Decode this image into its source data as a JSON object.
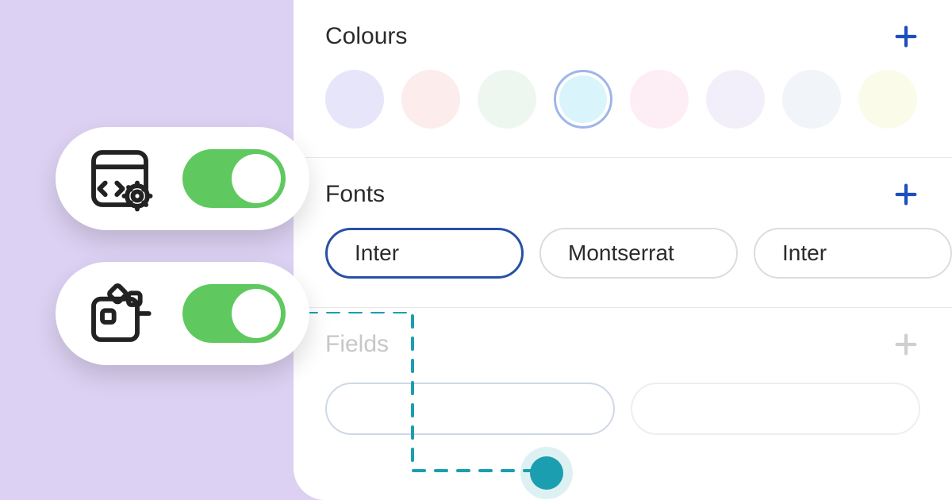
{
  "sections": {
    "colours": {
      "title": "Colours"
    },
    "fonts": {
      "title": "Fonts"
    },
    "fields": {
      "title": "Fields"
    }
  },
  "colour_swatches": [
    {
      "name": "lavender",
      "hex": "#e7e5fa",
      "selected": false
    },
    {
      "name": "blush",
      "hex": "#fcecec",
      "selected": false
    },
    {
      "name": "mint",
      "hex": "#edf7ef",
      "selected": false
    },
    {
      "name": "sky",
      "hex": "#d9f5fb",
      "selected": true
    },
    {
      "name": "rose",
      "hex": "#fceef4",
      "selected": false
    },
    {
      "name": "lilac",
      "hex": "#f3effa",
      "selected": false
    },
    {
      "name": "ice",
      "hex": "#f1f4f9",
      "selected": false
    },
    {
      "name": "cream",
      "hex": "#fafbe9",
      "selected": false
    }
  ],
  "big_swatch": {
    "hex": "#c4c4c4"
  },
  "fonts": [
    {
      "label": "Inter",
      "selected": true
    },
    {
      "label": "Montserrat",
      "selected": false
    },
    {
      "label": "Inter",
      "selected": false
    }
  ],
  "toggles": {
    "code_settings": {
      "on": true
    },
    "components": {
      "on": true
    }
  },
  "accent_color": "#1d4fbf",
  "connector_color": "#1a9eb0"
}
